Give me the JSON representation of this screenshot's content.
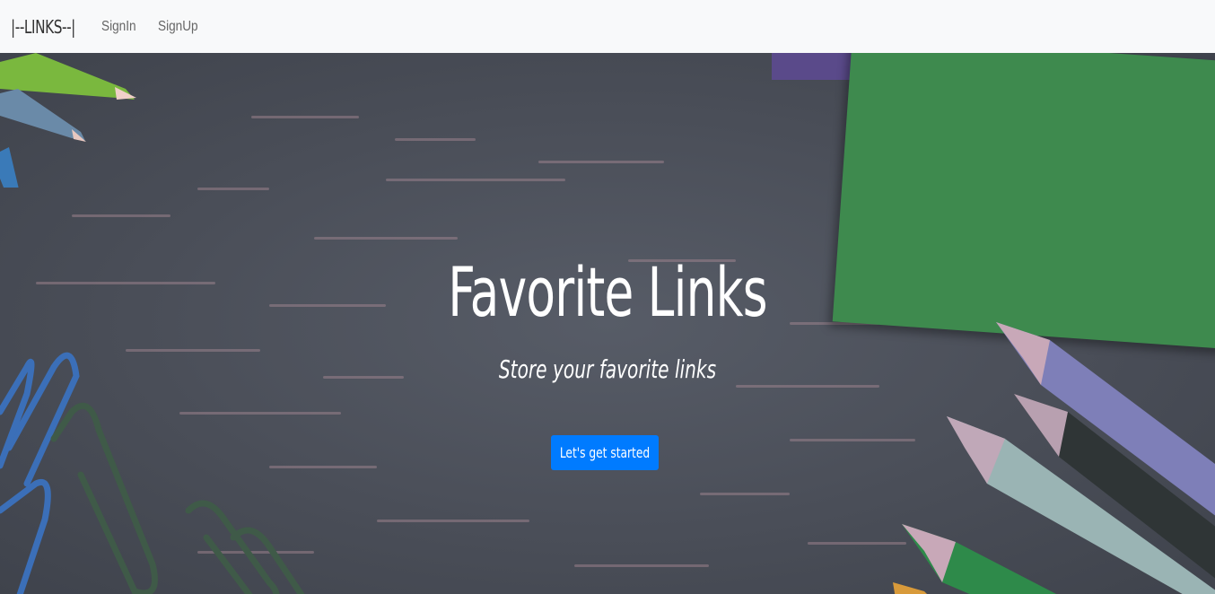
{
  "nav": {
    "brand": "|--LINKS--|",
    "links": [
      "SignIn",
      "SignUp"
    ]
  },
  "hero": {
    "title": "Favorite Links",
    "subtitle": "Store your favorite links",
    "cta_label": "Let's get started"
  },
  "colors": {
    "accent": "#007bff",
    "navbar_bg": "#f8f9fa",
    "notebook": "#3e8a4e"
  }
}
